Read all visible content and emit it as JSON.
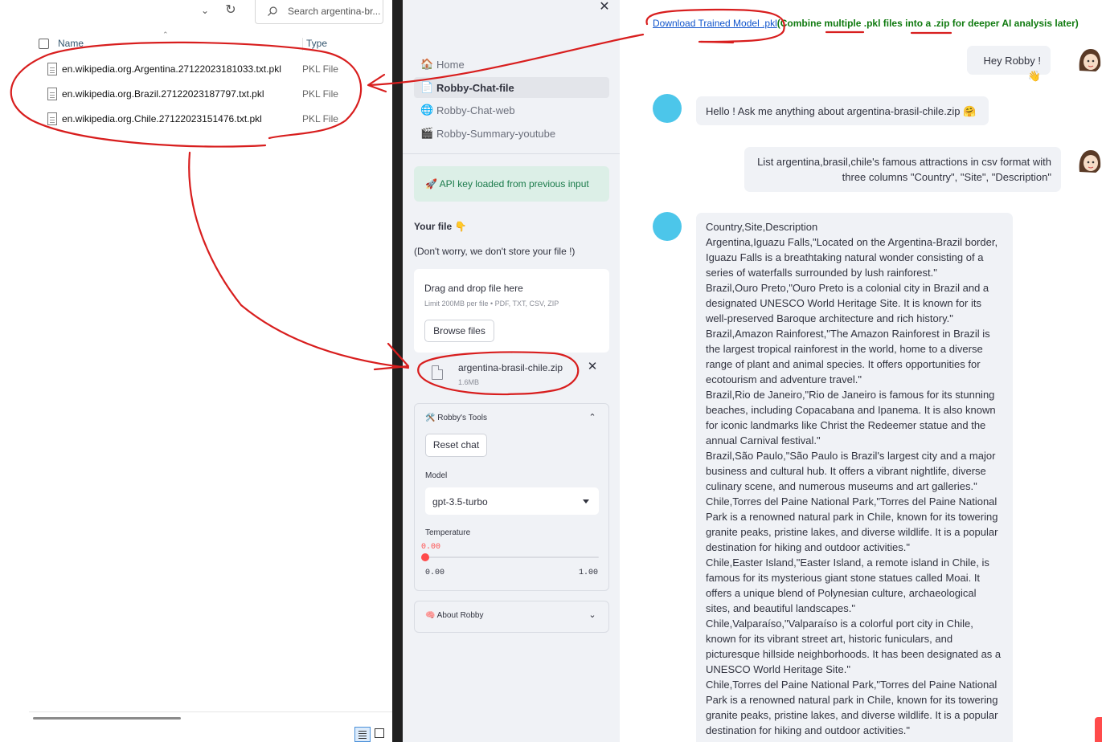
{
  "explorer": {
    "search_placeholder": "Search argentina-br...",
    "col_name": "Name",
    "col_type": "Type",
    "files": [
      {
        "name": "en.wikipedia.org.Argentina.27122023181033.txt.pkl",
        "type": "PKL File"
      },
      {
        "name": "en.wikipedia.org.Brazil.27122023187797.txt.pkl",
        "type": "PKL File"
      },
      {
        "name": "en.wikipedia.org.Chile.27122023151476.txt.pkl",
        "type": "PKL File"
      }
    ]
  },
  "sidebar": {
    "nav": [
      {
        "icon": "🏠",
        "label": "Home"
      },
      {
        "icon": "📄",
        "label": "Robby-Chat-file"
      },
      {
        "icon": "🌐",
        "label": "Robby-Chat-web"
      },
      {
        "icon": "🎬",
        "label": "Robby-Summary-youtube"
      }
    ],
    "api_success": "🚀 API key loaded from previous input",
    "your_file": "Your file 👇",
    "privacy_note": "(Don't worry, we don't store your file !)",
    "dropzone_title": "Drag and drop file here",
    "dropzone_limit": "Limit 200MB per file • PDF, TXT, CSV, ZIP",
    "browse_label": "Browse files",
    "uploaded_file_name": "argentina-brasil-chile.zip",
    "uploaded_file_size": "1.6MB",
    "tools_title": "🛠️ Robby's Tools",
    "reset_label": "Reset chat",
    "model_label": "Model",
    "model_value": "gpt-3.5-turbo",
    "temperature_label": "Temperature",
    "temperature_value": "0.00",
    "temperature_min": "0.00",
    "temperature_max": "1.00",
    "temperature_fraction": 0,
    "about_title": "🧠 About Robby"
  },
  "chat": {
    "download_link": "Download Trained Model .pkl",
    "download_note": "(Combine multiple .pkl files into a .zip for deeper AI analysis later)",
    "msg_user_1": "Hey Robby ! 👋",
    "msg_bot_1": "Hello ! Ask me anything about argentina-brasil-chile.zip 🤗",
    "msg_user_2_lines": [
      "List argentina,brasil,chile's famous attractions in csv format with",
      "three columns \"Country\", \"Site\", \"Description\""
    ],
    "csv_lines": [
      "Country,Site,Description",
      "Argentina,Iguazu Falls,\"Located on the Argentina-Brazil border,",
      "Iguazu Falls is a breathtaking natural wonder consisting of a",
      "series of waterfalls surrounded by lush rainforest.\"",
      "Brazil,Ouro Preto,\"Ouro Preto is a colonial city in Brazil and a",
      "designated UNESCO World Heritage Site. It is known for its",
      "well-preserved Baroque architecture and rich history.\"",
      "Brazil,Amazon Rainforest,\"The Amazon Rainforest in Brazil is",
      "the largest tropical rainforest in the world, home to a diverse",
      "range of plant and animal species. It offers opportunities for",
      "ecotourism and adventure travel.\"",
      "Brazil,Rio de Janeiro,\"Rio de Janeiro is famous for its stunning",
      "beaches, including Copacabana and Ipanema. It is also known",
      "for iconic landmarks like Christ the Redeemer statue and the",
      "annual Carnival festival.\"",
      "Brazil,São Paulo,\"São Paulo is Brazil's largest city and a major",
      "business and cultural hub. It offers a vibrant nightlife, diverse",
      "culinary scene, and numerous museums and art galleries.\"",
      "Chile,Torres del Paine National Park,\"Torres del Paine National",
      "Park is a renowned natural park in Chile, known for its towering",
      "granite peaks, pristine lakes, and diverse wildlife. It is a popular",
      "destination for hiking and outdoor activities.\"",
      "Chile,Easter Island,\"Easter Island, a remote island in Chile, is",
      "famous for its mysterious giant stone statues called Moai. It",
      "offers a unique blend of Polynesian culture, archaeological",
      "sites, and beautiful landscapes.\"",
      "Chile,Valparaíso,\"Valparaíso is a colorful port city in Chile,",
      "known for its vibrant street art, historic funiculars, and",
      "picturesque hillside neighborhoods. It has been designated as a",
      "UNESCO World Heritage Site.\"",
      "Chile,Torres del Paine National Park,\"Torres del Paine National",
      "Park is a renowned natural park in Chile, known for its towering",
      "granite peaks, pristine lakes, and diverse wildlife. It is a popular",
      "destination for hiking and outdoor activities.\""
    ]
  },
  "colors": {
    "accent": "#ff4b4b",
    "annotation": "#d81e1e",
    "link": "#1155cc",
    "note_green": "#0f7a0f"
  }
}
